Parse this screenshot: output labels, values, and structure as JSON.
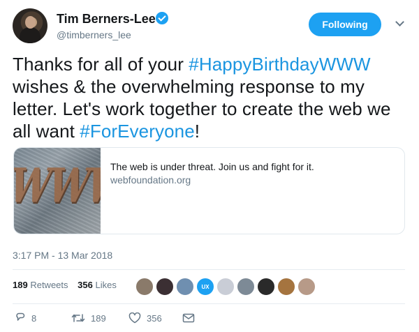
{
  "user": {
    "name": "Tim Berners-Lee",
    "handle": "@timberners_lee",
    "follow_label": "Following"
  },
  "tweet": {
    "segments": [
      {
        "text": "Thanks for all of your ",
        "tag": false
      },
      {
        "text": "#HappyBirthdayWWW",
        "tag": true
      },
      {
        "text": " wishes & the overwhelming response to my letter. Let's work together to create the web we all want ",
        "tag": false
      },
      {
        "text": "#ForEveryone",
        "tag": true
      },
      {
        "text": "!",
        "tag": false
      }
    ]
  },
  "card": {
    "title": "The web is under threat. Join us and fight for it.",
    "domain": "webfoundation.org",
    "image_text": "WWW"
  },
  "timestamp": "3:17 PM - 13 Mar 2018",
  "stats": {
    "retweets_count": "189",
    "retweets_label": "Retweets",
    "likes_count": "356",
    "likes_label": "Likes"
  },
  "likers": [
    {
      "color": "#8a7a6a"
    },
    {
      "color": "#3b2f33"
    },
    {
      "color": "#6f8fb0"
    },
    {
      "color": "#1da1f2",
      "label": "UX"
    },
    {
      "color": "#c9cdd6"
    },
    {
      "color": "#7d8a96"
    },
    {
      "color": "#2a2a2a"
    },
    {
      "color": "#a5743f"
    },
    {
      "color": "#b79a88"
    }
  ],
  "actions": {
    "reply_count": "8",
    "retweet_count": "189",
    "like_count": "356"
  },
  "colors": {
    "accent": "#1da1f2",
    "hashtag": "#1b95e0",
    "muted": "#657786"
  }
}
